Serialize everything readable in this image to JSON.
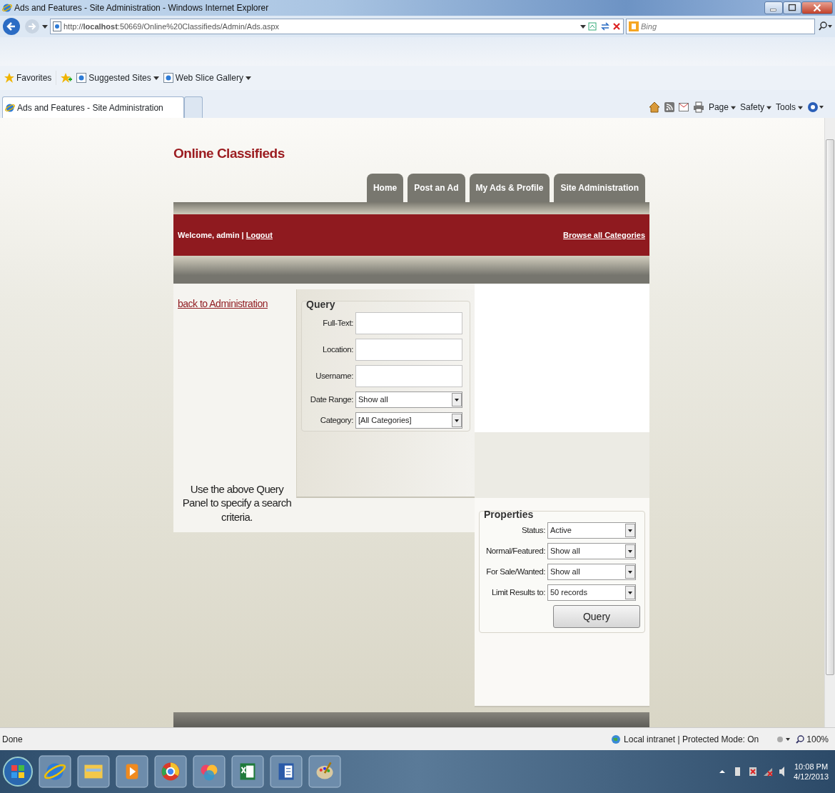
{
  "window": {
    "title": "Ads and Features - Site Administration - Windows Internet Explorer"
  },
  "address_bar": {
    "url": "http://**localhost**:50669/Online%20Classifieds/Admin/Ads.aspx"
  },
  "search": {
    "placeholder": "Bing"
  },
  "favorites_bar": {
    "label": "Favorites",
    "links": [
      "Suggested Sites",
      "Web Slice Gallery"
    ]
  },
  "browser_tabs": [
    {
      "label": "Ads and Features - Site Administration",
      "selected": true
    }
  ],
  "command_bar": [
    "Page",
    "Safety",
    "Tools"
  ],
  "site": {
    "title": "Online Classifieds",
    "nav_tabs": [
      "Home",
      "Post an Ad",
      "My Ads & Profile",
      "Site Administration"
    ],
    "welcome": "Welcome, admin",
    "separator": "|",
    "logout": "Logout",
    "browse_link": "Browse all Categories",
    "back_link": "back to Administration",
    "hint": "Use the above Query Panel to specify a search criteria."
  },
  "query_panel": {
    "legend": "Query",
    "fields": [
      {
        "label": "Full-Text:",
        "kind": "text"
      },
      {
        "label": "Location:",
        "kind": "text"
      },
      {
        "label": "Username:",
        "kind": "text"
      },
      {
        "label": "Date Range:",
        "kind": "select",
        "value": "Show all"
      },
      {
        "label": "Category:",
        "kind": "select",
        "value": "[All Categories]"
      }
    ]
  },
  "properties_panel": {
    "legend": "Properties",
    "fields": [
      {
        "label": "Status:",
        "kind": "select",
        "value": "Active"
      },
      {
        "label": "Normal/Featured:",
        "kind": "select",
        "value": "Show all"
      },
      {
        "label": "For Sale/Wanted:",
        "kind": "select",
        "value": "Show all"
      },
      {
        "label": "Limit Results to:",
        "kind": "select",
        "value": "50 records"
      }
    ],
    "button": "Query"
  },
  "status_bar": {
    "text": "Done",
    "zone": "Local intranet | Protected Mode: On",
    "zoom": "100%"
  },
  "taskbar": {
    "time": "10:08 PM",
    "date": "4/12/2013"
  }
}
